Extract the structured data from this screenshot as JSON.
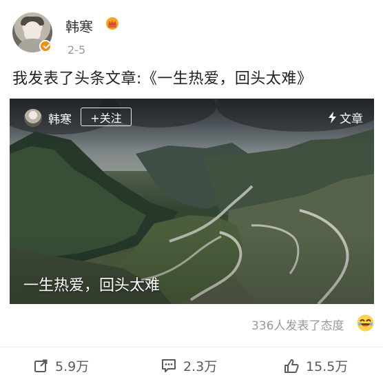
{
  "post": {
    "author": "韩寒",
    "date": "2-5",
    "text": "我发表了头条文章:《一生热爱，回头太难》"
  },
  "article_card": {
    "author": "韩寒",
    "follow_label": "+关注",
    "tag_label": "文章",
    "title": "一生热爱，回头太难"
  },
  "reactions": {
    "summary": "336人发表了态度"
  },
  "actions": {
    "share": "5.9万",
    "comment": "2.3万",
    "like": "15.5万"
  },
  "colors": {
    "accent": "#f28d16",
    "muted_text": "#999999",
    "body_text": "#222222"
  }
}
